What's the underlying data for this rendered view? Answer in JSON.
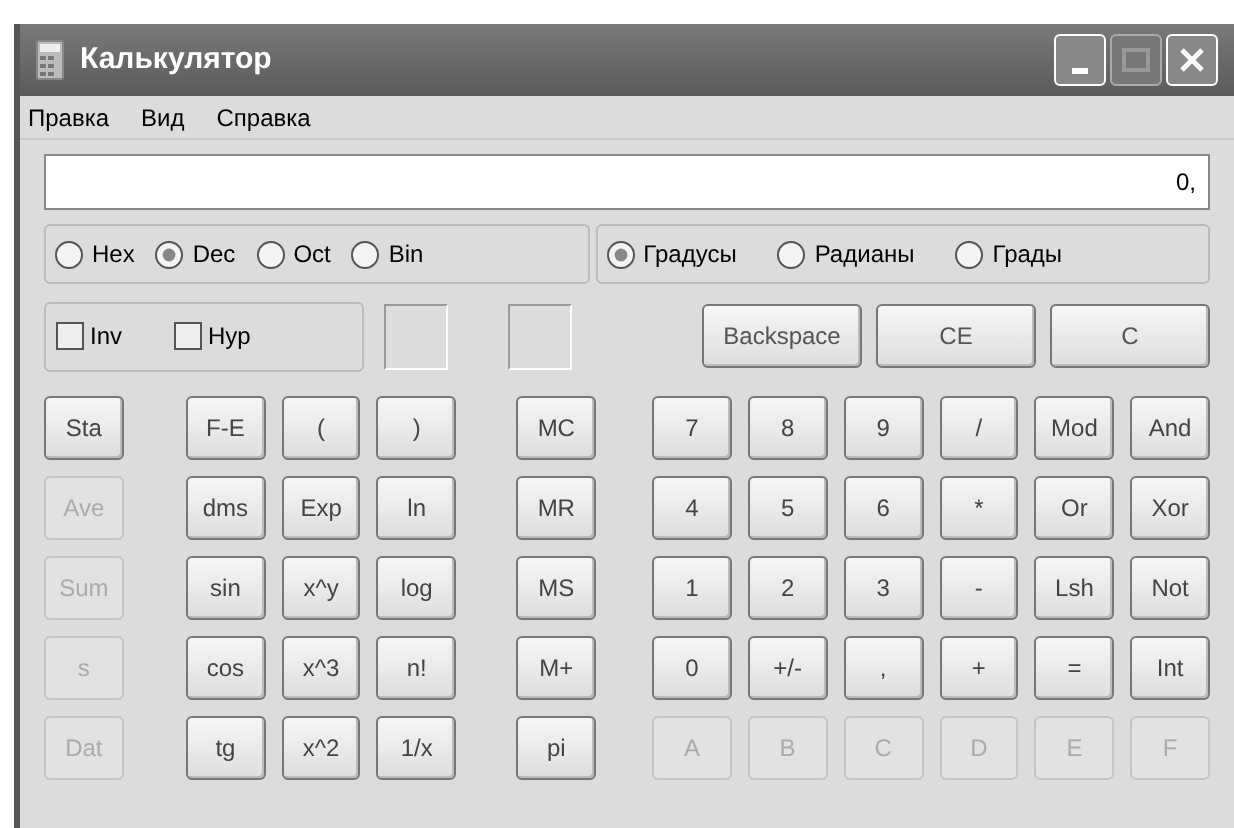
{
  "window": {
    "title": "Калькулятор",
    "maximize_disabled": true
  },
  "menu": [
    "Правка",
    "Вид",
    "Справка"
  ],
  "display": {
    "value": "0,"
  },
  "number_systems": [
    {
      "label": "Hex",
      "selected": false
    },
    {
      "label": "Dec",
      "selected": true
    },
    {
      "label": "Oct",
      "selected": false
    },
    {
      "label": "Bin",
      "selected": false
    }
  ],
  "angle_units": [
    {
      "label": "Градусы",
      "selected": true
    },
    {
      "label": "Радианы",
      "selected": false
    },
    {
      "label": "Грады",
      "selected": false
    }
  ],
  "modifiers": [
    {
      "label": "Inv",
      "checked": false
    },
    {
      "label": "Hyp",
      "checked": false
    }
  ],
  "edit_buttons": [
    "Backspace",
    "CE",
    "C"
  ],
  "button_rows": [
    [
      {
        "label": "Sta",
        "disabled": false
      },
      {
        "label": "F-E",
        "disabled": false
      },
      {
        "label": "(",
        "disabled": false
      },
      {
        "label": ")",
        "disabled": false
      },
      {
        "label": "MC",
        "disabled": false
      },
      {
        "label": "7",
        "disabled": false
      },
      {
        "label": "8",
        "disabled": false
      },
      {
        "label": "9",
        "disabled": false
      },
      {
        "label": "/",
        "disabled": false
      },
      {
        "label": "Mod",
        "disabled": false
      },
      {
        "label": "And",
        "disabled": false
      }
    ],
    [
      {
        "label": "Ave",
        "disabled": true
      },
      {
        "label": "dms",
        "disabled": false
      },
      {
        "label": "Exp",
        "disabled": false
      },
      {
        "label": "ln",
        "disabled": false
      },
      {
        "label": "MR",
        "disabled": false
      },
      {
        "label": "4",
        "disabled": false
      },
      {
        "label": "5",
        "disabled": false
      },
      {
        "label": "6",
        "disabled": false
      },
      {
        "label": "*",
        "disabled": false
      },
      {
        "label": "Or",
        "disabled": false
      },
      {
        "label": "Xor",
        "disabled": false
      }
    ],
    [
      {
        "label": "Sum",
        "disabled": true
      },
      {
        "label": "sin",
        "disabled": false
      },
      {
        "label": "x^y",
        "disabled": false
      },
      {
        "label": "log",
        "disabled": false
      },
      {
        "label": "MS",
        "disabled": false
      },
      {
        "label": "1",
        "disabled": false
      },
      {
        "label": "2",
        "disabled": false
      },
      {
        "label": "3",
        "disabled": false
      },
      {
        "label": "-",
        "disabled": false
      },
      {
        "label": "Lsh",
        "disabled": false
      },
      {
        "label": "Not",
        "disabled": false
      }
    ],
    [
      {
        "label": "s",
        "disabled": true
      },
      {
        "label": "cos",
        "disabled": false
      },
      {
        "label": "x^3",
        "disabled": false
      },
      {
        "label": "n!",
        "disabled": false
      },
      {
        "label": "M+",
        "disabled": false
      },
      {
        "label": "0",
        "disabled": false
      },
      {
        "label": "+/-",
        "disabled": false
      },
      {
        "label": ",",
        "disabled": false
      },
      {
        "label": "+",
        "disabled": false
      },
      {
        "label": "=",
        "disabled": false
      },
      {
        "label": "Int",
        "disabled": false
      }
    ],
    [
      {
        "label": "Dat",
        "disabled": true
      },
      {
        "label": "tg",
        "disabled": false
      },
      {
        "label": "x^2",
        "disabled": false
      },
      {
        "label": "1/x",
        "disabled": false
      },
      {
        "label": "pi",
        "disabled": false
      },
      {
        "label": "A",
        "disabled": true
      },
      {
        "label": "B",
        "disabled": true
      },
      {
        "label": "C",
        "disabled": true
      },
      {
        "label": "D",
        "disabled": true
      },
      {
        "label": "E",
        "disabled": true
      },
      {
        "label": "F",
        "disabled": true
      }
    ]
  ]
}
